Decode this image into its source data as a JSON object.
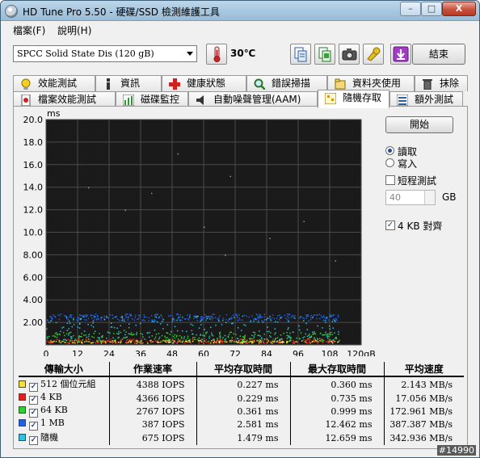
{
  "window": {
    "title": "HD Tune Pro 5.50 - 硬碟/SSD 檢測維護工具",
    "minimize": "–",
    "maximize": "□",
    "close": "X"
  },
  "menu": [
    {
      "label": "檔案(F)"
    },
    {
      "label": "說明(H)"
    }
  ],
  "toolbar": {
    "drive": "SPCC Solid State Dis (120 gB)",
    "temperature": "30℃",
    "exit_label": "結束",
    "icons": [
      "copy-text-icon",
      "copy-screenshot-icon",
      "camera-icon",
      "options-icon",
      "save-icon"
    ]
  },
  "tabs_top": [
    {
      "label": "效能測試",
      "icon": "lightbulb-icon"
    },
    {
      "label": "資訊",
      "icon": "info-icon"
    },
    {
      "label": "健康狀態",
      "icon": "health-cross-icon"
    },
    {
      "label": "錯誤掃描",
      "icon": "magnifier-icon"
    },
    {
      "label": "資料夾使用",
      "icon": "folder-icon"
    },
    {
      "label": "抹除",
      "icon": "trash-icon"
    }
  ],
  "tabs_bottom": [
    {
      "label": "檔案效能測試",
      "icon": "file-benchmark-icon"
    },
    {
      "label": "磁碟監控",
      "icon": "monitor-chart-icon"
    },
    {
      "label": "自動噪聲管理(AAM)",
      "icon": "speaker-icon"
    },
    {
      "label": "隨機存取",
      "icon": "random-access-icon",
      "active": true
    },
    {
      "label": "額外測試",
      "icon": "extra-tests-icon"
    }
  ],
  "controls": {
    "start_label": "開始",
    "read_label": "讀取",
    "write_label": "寫入",
    "short_test_label": "短程測試",
    "gb_value": "40",
    "gb_unit": "GB",
    "align_label": "4 KB 對齊"
  },
  "chart_data": {
    "type": "scatter",
    "ylabel": "ms",
    "xlabel": "gB",
    "ylim": [
      0,
      20
    ],
    "xlim": [
      0,
      120
    ],
    "yticks": [
      "20.0",
      "18.0",
      "16.0",
      "14.0",
      "12.0",
      "10.0",
      "8.00",
      "6.00",
      "4.00",
      "2.00"
    ],
    "xticks": [
      "0",
      "12",
      "24",
      "36",
      "48",
      "60",
      "72",
      "84",
      "96",
      "108",
      "120gB"
    ],
    "grid": true,
    "background": "#1a1a1a",
    "series": [
      {
        "name": "512 個位元組",
        "color": "#f0e040",
        "band": [
          0.2,
          0.45
        ]
      },
      {
        "name": "4 KB",
        "color": "#e02020",
        "band": [
          0.2,
          0.6
        ]
      },
      {
        "name": "64 KB",
        "color": "#30d030",
        "band": [
          0.3,
          1.2
        ]
      },
      {
        "name": "1 MB",
        "color": "#2060e0",
        "band": [
          2.2,
          2.8
        ]
      },
      {
        "name": "隨機",
        "color": "#30c0e0",
        "band": [
          0.5,
          2.6
        ]
      }
    ]
  },
  "table": {
    "headers": [
      "傳輸大小",
      "作業速率",
      "平均存取時間",
      "最大存取時間",
      "平均速度"
    ],
    "rows": [
      {
        "size": "512 個位元組",
        "color": "#f0e040",
        "rate": "4388 IOPS",
        "avg": "0.227 ms",
        "max": "0.360 ms",
        "speed": "2.143 MB/s"
      },
      {
        "size": "4 KB",
        "color": "#e02020",
        "rate": "4366 IOPS",
        "avg": "0.229 ms",
        "max": "0.735 ms",
        "speed": "17.056 MB/s"
      },
      {
        "size": "64 KB",
        "color": "#30d030",
        "rate": "2767 IOPS",
        "avg": "0.361 ms",
        "max": "0.999 ms",
        "speed": "172.961 MB/s"
      },
      {
        "size": "1 MB",
        "color": "#2060e0",
        "rate": "387 IOPS",
        "avg": "2.581 ms",
        "max": "12.462 ms",
        "speed": "387.387 MB/s"
      },
      {
        "size": "隨機",
        "color": "#30c0e0",
        "rate": "675 IOPS",
        "avg": "1.479 ms",
        "max": "12.659 ms",
        "speed": "342.936 MB/s"
      }
    ]
  },
  "watermark": "#14990"
}
